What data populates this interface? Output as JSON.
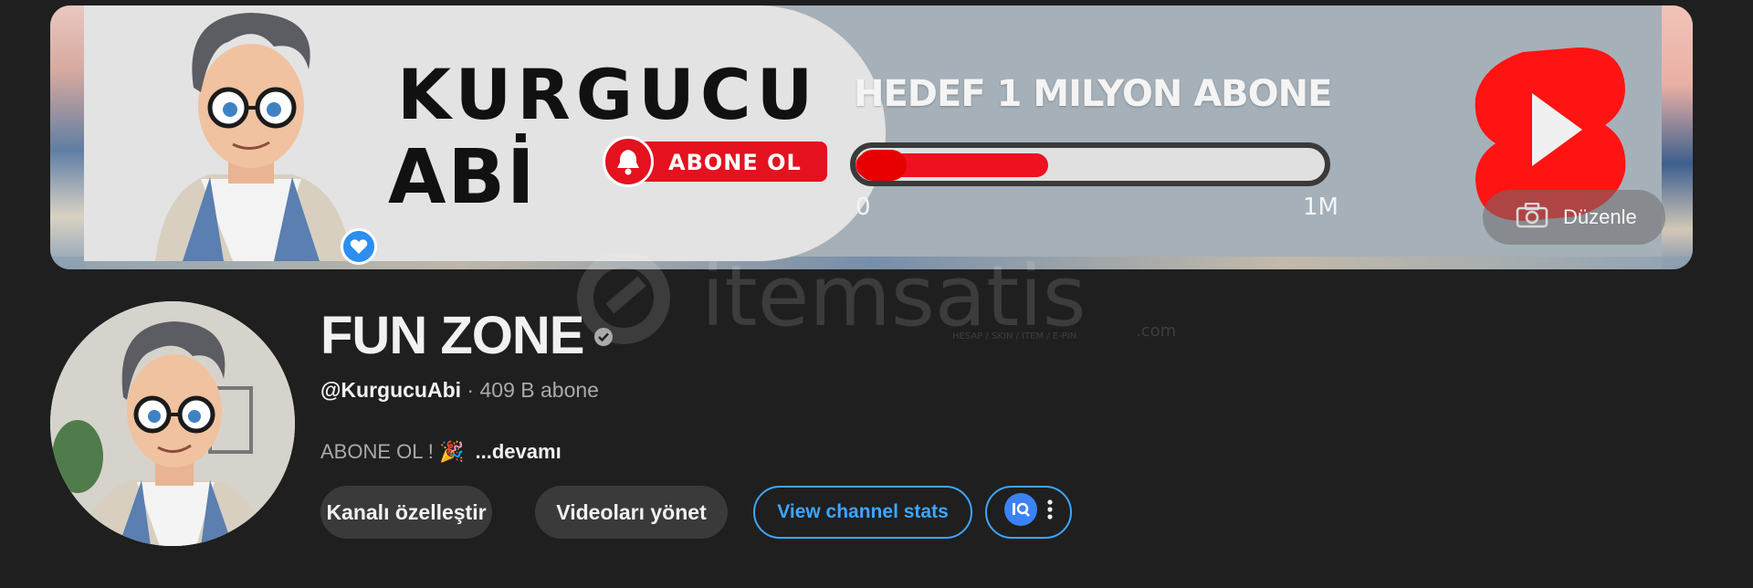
{
  "banner": {
    "brand_title": "KURGUCU",
    "brand_sub": "ABİ",
    "subscribe_label": "ABONE OL",
    "goal_text": "HEDEF 1 MILYON ABONE",
    "progress_min": "0",
    "progress_max": "1M",
    "progress_fraction": 0.41,
    "edit_label": "Düzenle"
  },
  "watermark": {
    "brand": "itemsatis",
    "tagline": "HESAP / SKIN / ITEM / E-PIN",
    "tld": ".com"
  },
  "channel": {
    "name": "FUN ZONE",
    "handle": "@KurgucuAbi",
    "separator": "·",
    "subscribers": "409 B abone",
    "description": "ABONE OL ! 🎉",
    "more_label": "...devamı"
  },
  "actions": {
    "customize_label": "Kanalı özelleştir",
    "manage_videos_label": "Videoları yönet",
    "stats_label": "View channel stats"
  },
  "colors": {
    "background": "#1f1f1f",
    "accent_blue": "#3ea6ff",
    "youtube_red": "#e4111e"
  },
  "icons": {
    "camera": "camera-icon",
    "verified": "verified-check-icon",
    "bell": "bell-icon",
    "shorts": "shorts-logo-icon",
    "extension": "extension-icon",
    "more": "more-vertical-icon",
    "heart": "heart-icon"
  }
}
